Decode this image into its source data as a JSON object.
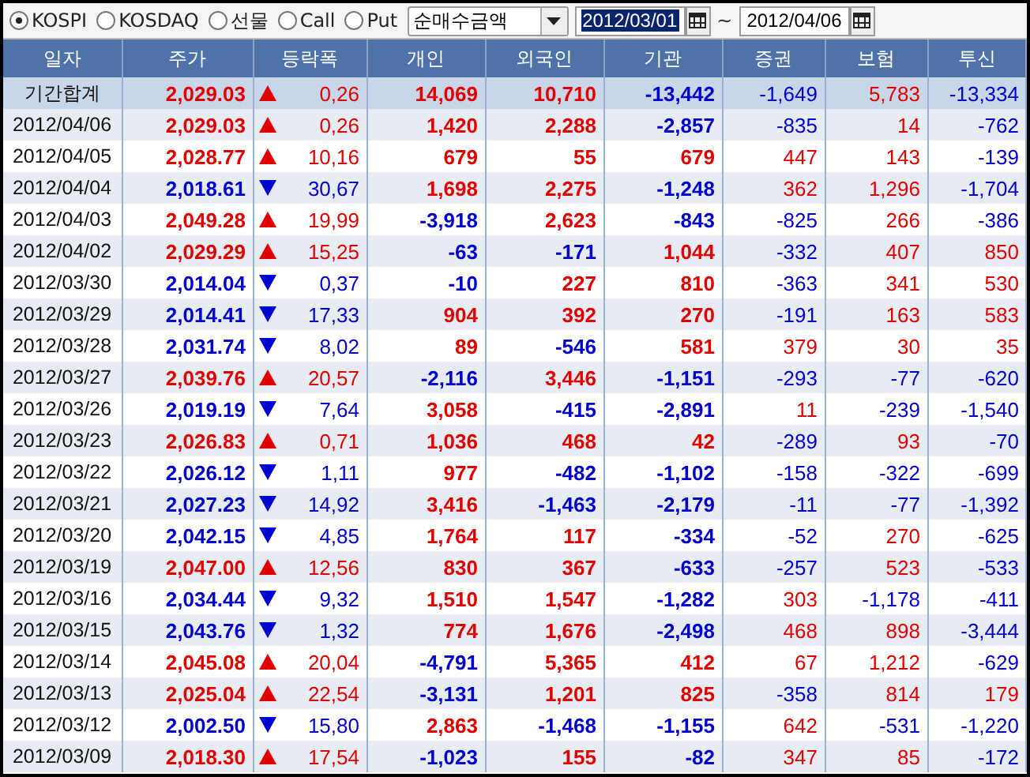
{
  "market_options": [
    {
      "label": "KOSPI",
      "selected": true
    },
    {
      "label": "KOSDAQ",
      "selected": false
    },
    {
      "label": "선물",
      "selected": false
    },
    {
      "label": "Call",
      "selected": false
    },
    {
      "label": "Put",
      "selected": false
    }
  ],
  "metric_dropdown": {
    "value": "순매수금액"
  },
  "date_from": {
    "value": "2012/03/01",
    "selected": true
  },
  "range_separator": "~",
  "date_to": {
    "value": "2012/04/06",
    "selected": false
  },
  "table": {
    "columns": [
      "일자",
      "주가",
      "등락폭",
      "개인",
      "외국인",
      "기관",
      "증권",
      "보험",
      "투신"
    ],
    "rows": [
      {
        "date": "기간합계",
        "summary": true,
        "price": "2,029.03",
        "rising": true,
        "change": "0,26",
        "values": [
          {
            "text": "14,069",
            "positive": true
          },
          {
            "text": "10,710",
            "positive": true
          },
          {
            "text": "-13,442",
            "positive": false
          },
          {
            "text": "-1,649",
            "positive": false
          },
          {
            "text": "5,783",
            "positive": true
          },
          {
            "text": "-13,334",
            "positive": false
          }
        ]
      },
      {
        "date": "2012/04/06",
        "summary": false,
        "price": "2,029.03",
        "rising": true,
        "change": "0,26",
        "values": [
          {
            "text": "1,420",
            "positive": true
          },
          {
            "text": "2,288",
            "positive": true
          },
          {
            "text": "-2,857",
            "positive": false
          },
          {
            "text": "-835",
            "positive": false
          },
          {
            "text": "14",
            "positive": true
          },
          {
            "text": "-762",
            "positive": false
          }
        ]
      },
      {
        "date": "2012/04/05",
        "summary": false,
        "price": "2,028.77",
        "rising": true,
        "change": "10,16",
        "values": [
          {
            "text": "679",
            "positive": true
          },
          {
            "text": "55",
            "positive": true
          },
          {
            "text": "679",
            "positive": true
          },
          {
            "text": "447",
            "positive": true
          },
          {
            "text": "143",
            "positive": true
          },
          {
            "text": "-139",
            "positive": false
          }
        ]
      },
      {
        "date": "2012/04/04",
        "summary": false,
        "price": "2,018.61",
        "rising": false,
        "change": "30,67",
        "values": [
          {
            "text": "1,698",
            "positive": true
          },
          {
            "text": "2,275",
            "positive": true
          },
          {
            "text": "-1,248",
            "positive": false
          },
          {
            "text": "362",
            "positive": true
          },
          {
            "text": "1,296",
            "positive": true
          },
          {
            "text": "-1,704",
            "positive": false
          }
        ]
      },
      {
        "date": "2012/04/03",
        "summary": false,
        "price": "2,049.28",
        "rising": true,
        "change": "19,99",
        "values": [
          {
            "text": "-3,918",
            "positive": false
          },
          {
            "text": "2,623",
            "positive": true
          },
          {
            "text": "-843",
            "positive": false
          },
          {
            "text": "-825",
            "positive": false
          },
          {
            "text": "266",
            "positive": true
          },
          {
            "text": "-386",
            "positive": false
          }
        ]
      },
      {
        "date": "2012/04/02",
        "summary": false,
        "price": "2,029.29",
        "rising": true,
        "change": "15,25",
        "values": [
          {
            "text": "-63",
            "positive": false
          },
          {
            "text": "-171",
            "positive": false
          },
          {
            "text": "1,044",
            "positive": true
          },
          {
            "text": "-332",
            "positive": false
          },
          {
            "text": "407",
            "positive": true
          },
          {
            "text": "850",
            "positive": true
          }
        ]
      },
      {
        "date": "2012/03/30",
        "summary": false,
        "price": "2,014.04",
        "rising": false,
        "change": "0,37",
        "values": [
          {
            "text": "-10",
            "positive": false
          },
          {
            "text": "227",
            "positive": true
          },
          {
            "text": "810",
            "positive": true
          },
          {
            "text": "-363",
            "positive": false
          },
          {
            "text": "341",
            "positive": true
          },
          {
            "text": "530",
            "positive": true
          }
        ]
      },
      {
        "date": "2012/03/29",
        "summary": false,
        "price": "2,014.41",
        "rising": false,
        "change": "17,33",
        "values": [
          {
            "text": "904",
            "positive": true
          },
          {
            "text": "392",
            "positive": true
          },
          {
            "text": "270",
            "positive": true
          },
          {
            "text": "-191",
            "positive": false
          },
          {
            "text": "163",
            "positive": true
          },
          {
            "text": "583",
            "positive": true
          }
        ]
      },
      {
        "date": "2012/03/28",
        "summary": false,
        "price": "2,031.74",
        "rising": false,
        "change": "8,02",
        "values": [
          {
            "text": "89",
            "positive": true
          },
          {
            "text": "-546",
            "positive": false
          },
          {
            "text": "581",
            "positive": true
          },
          {
            "text": "379",
            "positive": true
          },
          {
            "text": "30",
            "positive": true
          },
          {
            "text": "35",
            "positive": true
          }
        ]
      },
      {
        "date": "2012/03/27",
        "summary": false,
        "price": "2,039.76",
        "rising": true,
        "change": "20,57",
        "values": [
          {
            "text": "-2,116",
            "positive": false
          },
          {
            "text": "3,446",
            "positive": true
          },
          {
            "text": "-1,151",
            "positive": false
          },
          {
            "text": "-293",
            "positive": false
          },
          {
            "text": "-77",
            "positive": false
          },
          {
            "text": "-620",
            "positive": false
          }
        ]
      },
      {
        "date": "2012/03/26",
        "summary": false,
        "price": "2,019.19",
        "rising": false,
        "change": "7,64",
        "values": [
          {
            "text": "3,058",
            "positive": true
          },
          {
            "text": "-415",
            "positive": false
          },
          {
            "text": "-2,891",
            "positive": false
          },
          {
            "text": "11",
            "positive": true
          },
          {
            "text": "-239",
            "positive": false
          },
          {
            "text": "-1,540",
            "positive": false
          }
        ]
      },
      {
        "date": "2012/03/23",
        "summary": false,
        "price": "2,026.83",
        "rising": true,
        "change": "0,71",
        "values": [
          {
            "text": "1,036",
            "positive": true
          },
          {
            "text": "468",
            "positive": true
          },
          {
            "text": "42",
            "positive": true
          },
          {
            "text": "-289",
            "positive": false
          },
          {
            "text": "93",
            "positive": true
          },
          {
            "text": "-70",
            "positive": false
          }
        ]
      },
      {
        "date": "2012/03/22",
        "summary": false,
        "price": "2,026.12",
        "rising": false,
        "change": "1,11",
        "values": [
          {
            "text": "977",
            "positive": true
          },
          {
            "text": "-482",
            "positive": false
          },
          {
            "text": "-1,102",
            "positive": false
          },
          {
            "text": "-158",
            "positive": false
          },
          {
            "text": "-322",
            "positive": false
          },
          {
            "text": "-699",
            "positive": false
          }
        ]
      },
      {
        "date": "2012/03/21",
        "summary": false,
        "price": "2,027.23",
        "rising": false,
        "change": "14,92",
        "values": [
          {
            "text": "3,416",
            "positive": true
          },
          {
            "text": "-1,463",
            "positive": false
          },
          {
            "text": "-2,179",
            "positive": false
          },
          {
            "text": "-11",
            "positive": false
          },
          {
            "text": "-77",
            "positive": false
          },
          {
            "text": "-1,392",
            "positive": false
          }
        ]
      },
      {
        "date": "2012/03/20",
        "summary": false,
        "price": "2,042.15",
        "rising": false,
        "change": "4,85",
        "values": [
          {
            "text": "1,764",
            "positive": true
          },
          {
            "text": "117",
            "positive": true
          },
          {
            "text": "-334",
            "positive": false
          },
          {
            "text": "-52",
            "positive": false
          },
          {
            "text": "270",
            "positive": true
          },
          {
            "text": "-625",
            "positive": false
          }
        ]
      },
      {
        "date": "2012/03/19",
        "summary": false,
        "price": "2,047.00",
        "rising": true,
        "change": "12,56",
        "values": [
          {
            "text": "830",
            "positive": true
          },
          {
            "text": "367",
            "positive": true
          },
          {
            "text": "-633",
            "positive": false
          },
          {
            "text": "-257",
            "positive": false
          },
          {
            "text": "523",
            "positive": true
          },
          {
            "text": "-533",
            "positive": false
          }
        ]
      },
      {
        "date": "2012/03/16",
        "summary": false,
        "price": "2,034.44",
        "rising": false,
        "change": "9,32",
        "values": [
          {
            "text": "1,510",
            "positive": true
          },
          {
            "text": "1,547",
            "positive": true
          },
          {
            "text": "-1,282",
            "positive": false
          },
          {
            "text": "303",
            "positive": true
          },
          {
            "text": "-1,178",
            "positive": false
          },
          {
            "text": "-411",
            "positive": false
          }
        ]
      },
      {
        "date": "2012/03/15",
        "summary": false,
        "price": "2,043.76",
        "rising": false,
        "change": "1,32",
        "values": [
          {
            "text": "774",
            "positive": true
          },
          {
            "text": "1,676",
            "positive": true
          },
          {
            "text": "-2,498",
            "positive": false
          },
          {
            "text": "468",
            "positive": true
          },
          {
            "text": "898",
            "positive": true
          },
          {
            "text": "-3,444",
            "positive": false
          }
        ]
      },
      {
        "date": "2012/03/14",
        "summary": false,
        "price": "2,045.08",
        "rising": true,
        "change": "20,04",
        "values": [
          {
            "text": "-4,791",
            "positive": false
          },
          {
            "text": "5,365",
            "positive": true
          },
          {
            "text": "412",
            "positive": true
          },
          {
            "text": "67",
            "positive": true
          },
          {
            "text": "1,212",
            "positive": true
          },
          {
            "text": "-629",
            "positive": false
          }
        ]
      },
      {
        "date": "2012/03/13",
        "summary": false,
        "price": "2,025.04",
        "rising": true,
        "change": "22,54",
        "values": [
          {
            "text": "-3,131",
            "positive": false
          },
          {
            "text": "1,201",
            "positive": true
          },
          {
            "text": "825",
            "positive": true
          },
          {
            "text": "-358",
            "positive": false
          },
          {
            "text": "814",
            "positive": true
          },
          {
            "text": "179",
            "positive": true
          }
        ]
      },
      {
        "date": "2012/03/12",
        "summary": false,
        "price": "2,002.50",
        "rising": false,
        "change": "15,80",
        "values": [
          {
            "text": "2,863",
            "positive": true
          },
          {
            "text": "-1,468",
            "positive": false
          },
          {
            "text": "-1,155",
            "positive": false
          },
          {
            "text": "642",
            "positive": true
          },
          {
            "text": "-531",
            "positive": false
          },
          {
            "text": "-1,220",
            "positive": false
          }
        ]
      },
      {
        "date": "2012/03/09",
        "summary": false,
        "price": "2,018.30",
        "rising": true,
        "change": "17,54",
        "values": [
          {
            "text": "-1,023",
            "positive": false
          },
          {
            "text": "155",
            "positive": true
          },
          {
            "text": "-82",
            "positive": false
          },
          {
            "text": "347",
            "positive": true
          },
          {
            "text": "85",
            "positive": true
          },
          {
            "text": "-172",
            "positive": false
          }
        ]
      }
    ]
  }
}
